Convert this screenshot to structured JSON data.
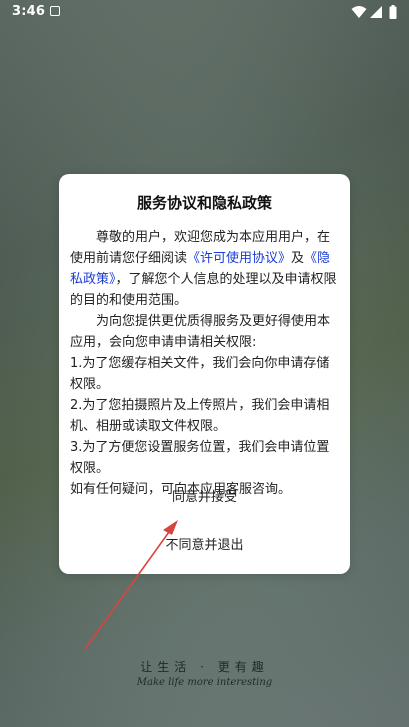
{
  "status_bar": {
    "time": "3:46",
    "icons": [
      "app-notification-icon",
      "wifi-icon",
      "signal-icon",
      "battery-icon"
    ]
  },
  "dialog": {
    "title": "服务协议和隐私政策",
    "intro_before": "尊敬的用户，欢迎您成为本应用用户，在使用前请您仔细阅读",
    "license_link": "《许可使用协议》",
    "and_word": "及",
    "privacy_link": "《隐私政策》",
    "intro_after": "，了解您个人信息的处理以及申请权限的目的和使用范围。",
    "service_para": "为向您提供更优质得服务及更好得使用本应用，会向您申请申请相关权限:",
    "items": [
      "1.为了您缓存相关文件，我们会向你申请存储权限。",
      "2.为了您拍摄照片及上传照片，我们会申请相机、相册或读取文件权限。",
      "3.为了方便您设置服务位置，我们会申请位置权限。"
    ],
    "contact": "如有任何疑问，可向本应用客服咨询。",
    "agree_label": "同意并接受",
    "exit_label": "不同意并退出"
  },
  "annotation": {
    "arrow_color": "#d9443f"
  },
  "slogan": {
    "cn": "让生活 · 更有趣",
    "en": "Make life more interesting"
  }
}
